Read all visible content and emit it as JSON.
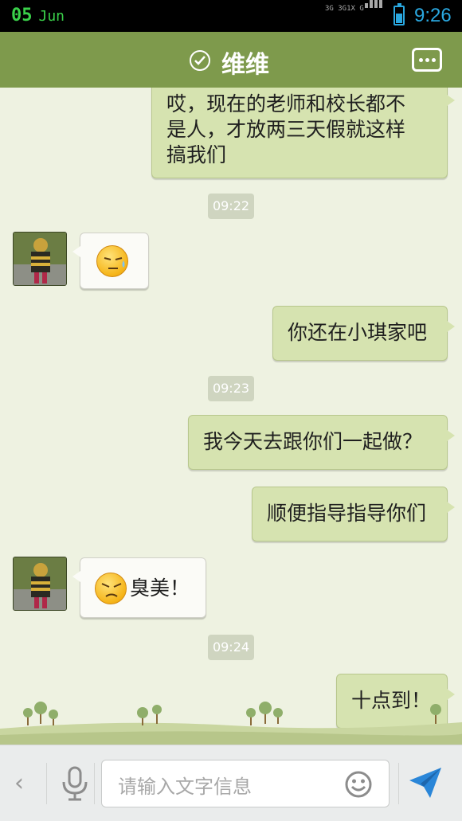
{
  "status_bar": {
    "day": "05",
    "month": "Jun",
    "network_top": "3G 3G1X G",
    "time": "9:26",
    "battery_level": 0.5
  },
  "header": {
    "title": "维维",
    "verified_icon": "check-circle-icon",
    "menu_icon": "more-dots-icon"
  },
  "messages": [
    {
      "type": "out",
      "text_lines": [
        "哎，现在的老师和校长都不",
        "是人，才放两三天假就这样",
        "搞我们"
      ]
    },
    {
      "type": "time",
      "text": "09:22"
    },
    {
      "type": "in",
      "emoji": "sweat-face-emoji",
      "text": ""
    },
    {
      "type": "out",
      "text": "你还在小琪家吧"
    },
    {
      "type": "time",
      "text": "09:23"
    },
    {
      "type": "out",
      "text": "我今天去跟你们一起做？"
    },
    {
      "type": "out",
      "text": "顺便指导指导你们"
    },
    {
      "type": "in",
      "emoji": "annoyed-face-emoji",
      "text": "臭美！"
    },
    {
      "type": "time",
      "text": "09:24"
    },
    {
      "type": "out",
      "text": "十点到！"
    }
  ],
  "input_bar": {
    "placeholder": "请输入文字信息",
    "back_icon": "chevron-left-icon",
    "mic_icon": "microphone-icon",
    "emoji_icon": "smiley-icon",
    "send_icon": "send-plane-icon"
  },
  "colors": {
    "header": "#7e9a4c",
    "chat_background": "#eef2e1",
    "outgoing_bubble": "#d6e3b0",
    "incoming_bubble": "#fbfbf7",
    "status_date": "#3ad14a",
    "status_time": "#2aa8e0",
    "send": "#2a86d8"
  }
}
